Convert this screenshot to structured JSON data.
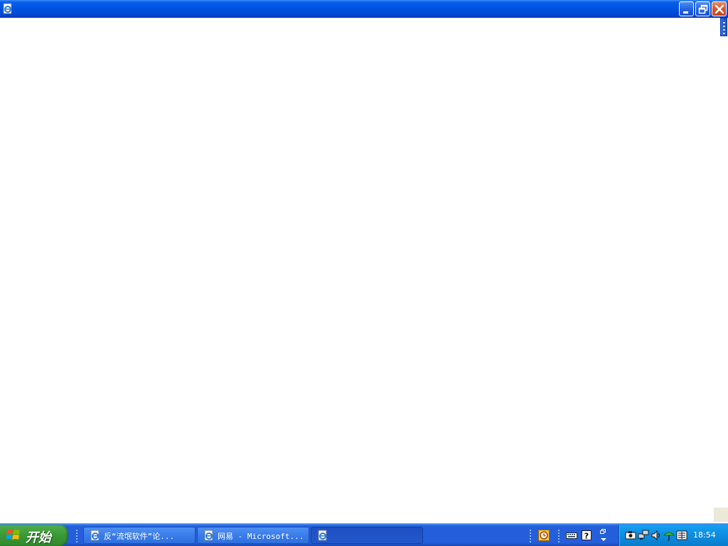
{
  "window": {
    "title": "",
    "icon": "ie-page-icon",
    "buttons": [
      "minimize",
      "restore",
      "close"
    ]
  },
  "taskbar": {
    "start_label": "开始",
    "tasks": [
      {
        "label": "反“流氓软件”论...",
        "icon": "ie-page-icon",
        "active": false
      },
      {
        "label": "网易 - Microsoft...",
        "icon": "ie-page-icon",
        "active": false
      },
      {
        "label": "",
        "icon": "ie-page-icon",
        "active": true
      }
    ],
    "toolbar_icons": [
      "clock-app-icon",
      "keyboard-icon",
      "help-icon",
      "restore-small-icon"
    ],
    "tray_icons": [
      "camera-icon",
      "network-icon",
      "sound-icon",
      "umbrella-icon",
      "ime-icon"
    ],
    "clock": "18:54"
  },
  "colors": {
    "titlebar": "#0054e3",
    "taskbar": "#245edb",
    "start_button": "#3c9a37",
    "tray": "#0d8de0",
    "close_button": "#d9552b"
  }
}
